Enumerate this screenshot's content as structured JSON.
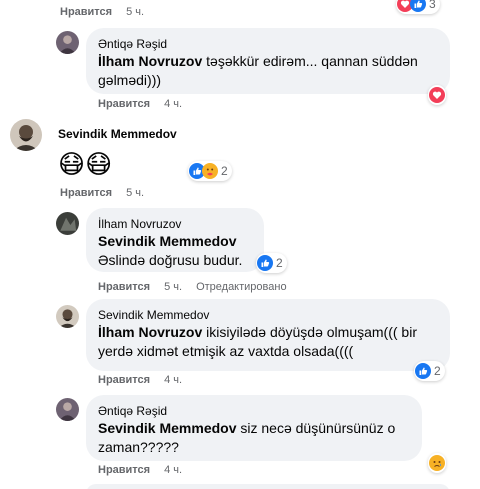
{
  "comments": [
    {
      "meta": {
        "like": "Нравится",
        "time": "5 ч."
      },
      "reactions": {
        "count": "3"
      }
    },
    {
      "author": "Əntiqə Rəşid",
      "mention": "İlham Novruzov",
      "text": " təşəkkür edirəm... qannan süddən gəlmədi)))",
      "meta": {
        "like": "Нравится",
        "time": "4 ч."
      },
      "reactions": {
        "count": ""
      }
    },
    {
      "author": "Sevindik Memmedov",
      "text": "😷😷",
      "meta": {
        "like": "Нравится",
        "time": "5 ч."
      },
      "reactions": {
        "count": "2"
      }
    },
    {
      "author": "İlham Novruzov",
      "mention": "Sevindik Memmedov",
      "text": "Əslində doğrusu budur.",
      "meta": {
        "like": "Нравится",
        "time": "5 ч.",
        "edited": "Отредактировано"
      },
      "reactions": {
        "count": "2"
      }
    },
    {
      "author": "Sevindik Memmedov",
      "mention": "İlham Novruzov",
      "text": " ikisiyilədə döyüşdə olmuşam((( bir yerdə xidmət etmişik az vaxtda olsada((((",
      "meta": {
        "like": "Нравится",
        "time": "4 ч."
      },
      "reactions": {
        "count": "2"
      }
    },
    {
      "author": "Əntiqə Rəşid",
      "mention": "Sevindik Memmedov",
      "text": " siz necə düşünürsünüz o zaman?????",
      "meta": {
        "like": "Нравится",
        "time": "4 ч."
      },
      "reactions": {
        "count": ""
      }
    }
  ],
  "colors": {
    "like": "#1877f2",
    "love": "#f33e58",
    "haha": "#f7b125",
    "meta": "#65676b",
    "bubble": "#f0f2f5"
  },
  "icons": [
    "like-reaction-icon",
    "love-reaction-icon",
    "care-reaction-icon",
    "sad-reaction-icon"
  ]
}
